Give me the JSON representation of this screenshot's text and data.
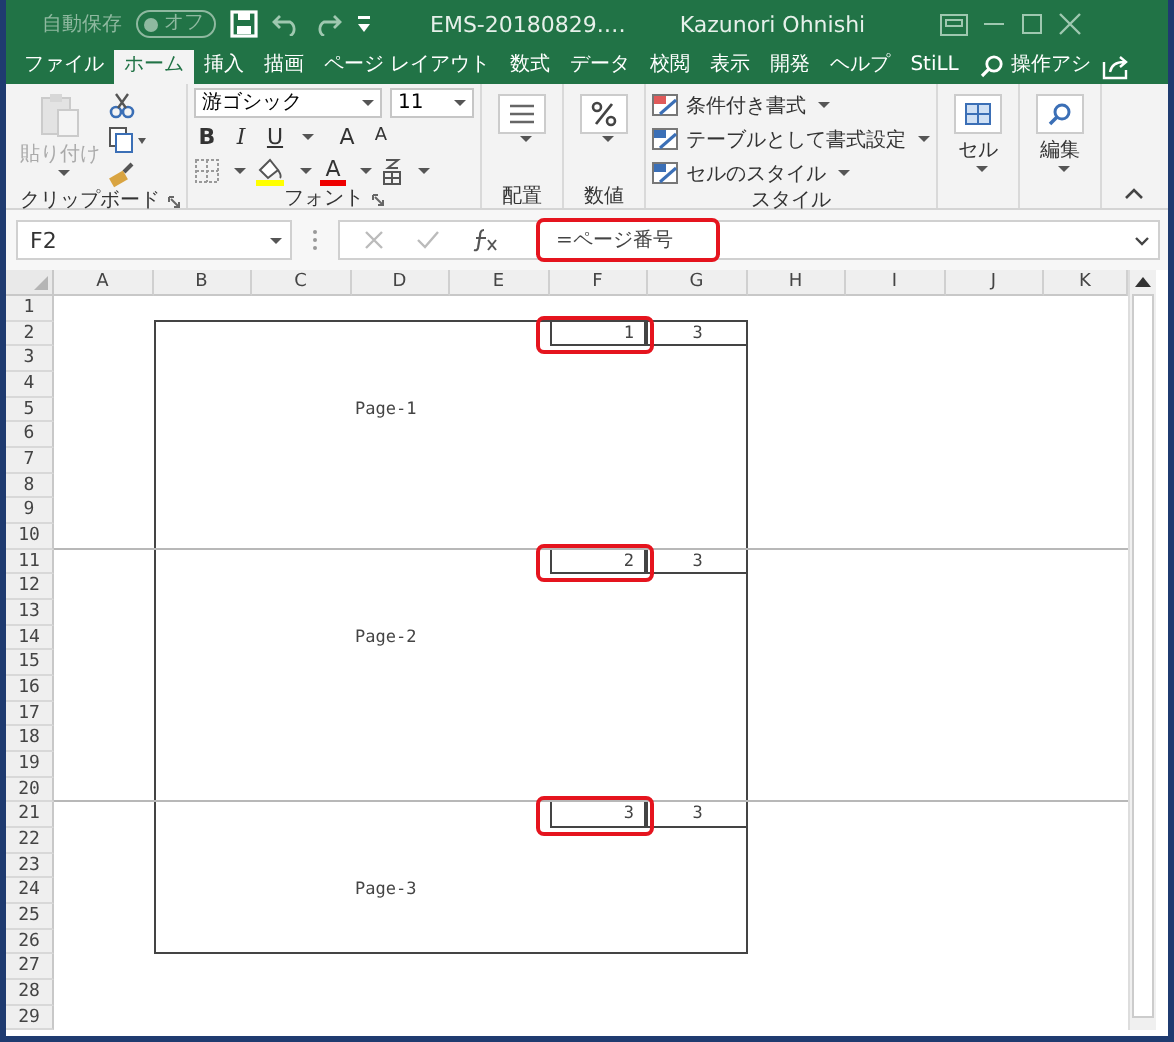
{
  "title_bar": {
    "autosave_label": "自動保存",
    "autosave_on": false,
    "autosave_state": "オフ",
    "document_title": "EMS-20180829.…",
    "user": "Kazunori Ohnishi"
  },
  "tabs": [
    {
      "label": "ファイル",
      "selected": false
    },
    {
      "label": "ホーム",
      "selected": true
    },
    {
      "label": "挿入",
      "selected": false
    },
    {
      "label": "描画",
      "selected": false
    },
    {
      "label": "ページ レイアウト",
      "selected": false
    },
    {
      "label": "数式",
      "selected": false
    },
    {
      "label": "データ",
      "selected": false
    },
    {
      "label": "校閲",
      "selected": false
    },
    {
      "label": "表示",
      "selected": false
    },
    {
      "label": "開発",
      "selected": false
    },
    {
      "label": "ヘルプ",
      "selected": false
    },
    {
      "label": "StiLL",
      "selected": false
    }
  ],
  "tell_me": "操作アシ",
  "ribbon": {
    "clipboard": {
      "paste": "貼り付け",
      "paste_disabled": true,
      "label": "クリップボード"
    },
    "font": {
      "name": "游ゴシック",
      "size": "11",
      "format_buttons": [
        "B",
        "I",
        "U"
      ],
      "size_buttons": [
        "A",
        "A"
      ],
      "font_color_letter": "A",
      "label": "フォント"
    },
    "alignment": {
      "label": "配置"
    },
    "number": {
      "label": "数値"
    },
    "styles": {
      "items": [
        "条件付き書式",
        "テーブルとして書式設定",
        "セルのスタイル"
      ],
      "label": "スタイル"
    },
    "cells": {
      "label": "セル"
    },
    "editing": {
      "label": "編集"
    }
  },
  "formula_bar": {
    "name_box": "F2",
    "formula": "=ページ番号",
    "highlighted": true
  },
  "sheet": {
    "columns": [
      "A",
      "B",
      "C",
      "D",
      "E",
      "F",
      "G",
      "H",
      "I",
      "J",
      "K"
    ],
    "rows": [
      "1",
      "2",
      "3",
      "4",
      "5",
      "6",
      "7",
      "8",
      "9",
      "10",
      "11",
      "12",
      "13",
      "14",
      "15",
      "16",
      "17",
      "18",
      "19",
      "20",
      "21",
      "22",
      "23",
      "24",
      "25",
      "26",
      "27",
      "28",
      "29"
    ],
    "pages": [
      {
        "label": "Page-1",
        "page_number": "1",
        "page_total": "3",
        "highlighted": true
      },
      {
        "label": "Page-2",
        "page_number": "2",
        "page_total": "3",
        "highlighted": true
      },
      {
        "label": "Page-3",
        "page_number": "3",
        "page_total": "3",
        "highlighted": true
      }
    ]
  }
}
